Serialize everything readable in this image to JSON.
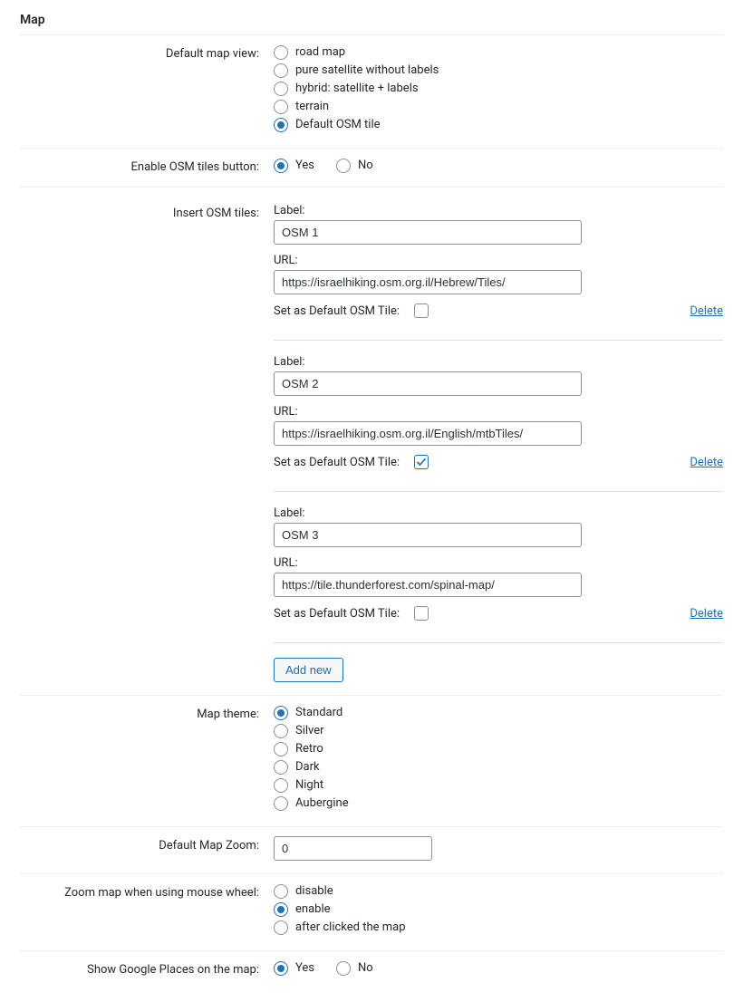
{
  "section_title": "Map",
  "default_map_view": {
    "label": "Default map view:",
    "options": [
      {
        "label": "road map",
        "checked": false
      },
      {
        "label": "pure satellite without labels",
        "checked": false
      },
      {
        "label": "hybrid: satellite + labels",
        "checked": false
      },
      {
        "label": "terrain",
        "checked": false
      },
      {
        "label": "Default OSM tile",
        "checked": true
      }
    ]
  },
  "enable_osm_tiles_button": {
    "label": "Enable OSM tiles button:",
    "options": [
      {
        "label": "Yes",
        "checked": true
      },
      {
        "label": "No",
        "checked": false
      }
    ]
  },
  "insert_osm_tiles": {
    "label": "Insert OSM tiles:",
    "field_label_label": "Label:",
    "field_url_label": "URL:",
    "set_default_label": "Set as Default OSM Tile:",
    "delete_label": "Delete",
    "add_new_label": "Add new",
    "tiles": [
      {
        "label": "OSM 1",
        "url": "https://israelhiking.osm.org.il/Hebrew/Tiles/",
        "default": false
      },
      {
        "label": "OSM 2",
        "url": "https://israelhiking.osm.org.il/English/mtbTiles/",
        "default": true
      },
      {
        "label": "OSM 3",
        "url": "https://tile.thunderforest.com/spinal-map/",
        "default": false
      }
    ]
  },
  "map_theme": {
    "label": "Map theme:",
    "options": [
      {
        "label": "Standard",
        "checked": true
      },
      {
        "label": "Silver",
        "checked": false
      },
      {
        "label": "Retro",
        "checked": false
      },
      {
        "label": "Dark",
        "checked": false
      },
      {
        "label": "Night",
        "checked": false
      },
      {
        "label": "Aubergine",
        "checked": false
      }
    ]
  },
  "default_map_zoom": {
    "label": "Default Map Zoom:",
    "value": "0"
  },
  "zoom_mouse_wheel": {
    "label": "Zoom map when using mouse wheel:",
    "options": [
      {
        "label": "disable",
        "checked": false
      },
      {
        "label": "enable",
        "checked": true
      },
      {
        "label": "after clicked the map",
        "checked": false
      }
    ]
  },
  "show_google_places": {
    "label": "Show Google Places on the map:",
    "options": [
      {
        "label": "Yes",
        "checked": true
      },
      {
        "label": "No",
        "checked": false
      }
    ]
  }
}
